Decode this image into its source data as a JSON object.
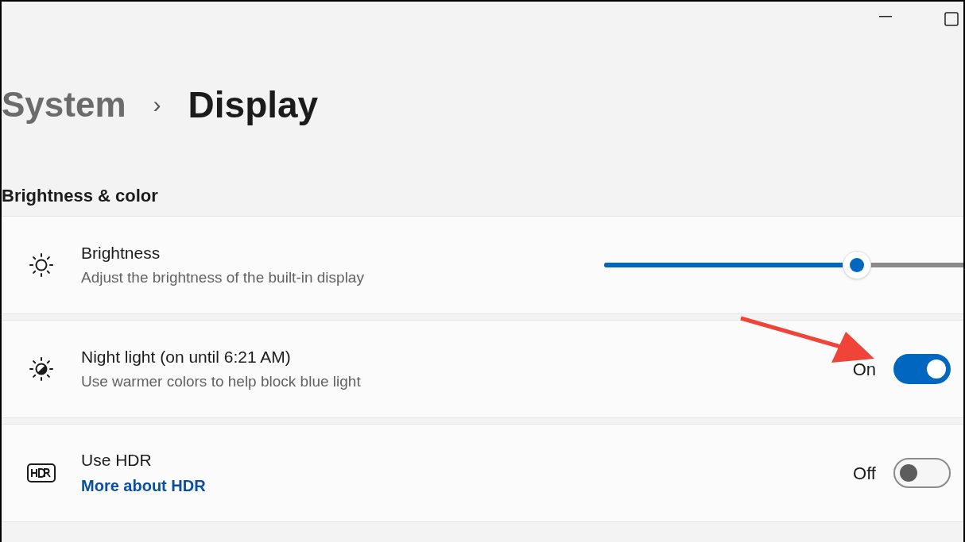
{
  "breadcrumb": {
    "parent": "System",
    "separator": "›",
    "current": "Display"
  },
  "section": {
    "title": "Brightness & color"
  },
  "settings": [
    {
      "kind": "slider",
      "title": "Brightness",
      "description": "Adjust the brightness of the built-in display",
      "level": 0.7
    },
    {
      "kind": "toggle",
      "title": "Night light (on until 6:21 AM)",
      "description": "Use warmer colors to help block blue light",
      "on": true,
      "state_label": "On"
    },
    {
      "kind": "toggle",
      "title": "Use HDR",
      "link": "More about HDR",
      "on": false,
      "state_label": "Off"
    }
  ]
}
